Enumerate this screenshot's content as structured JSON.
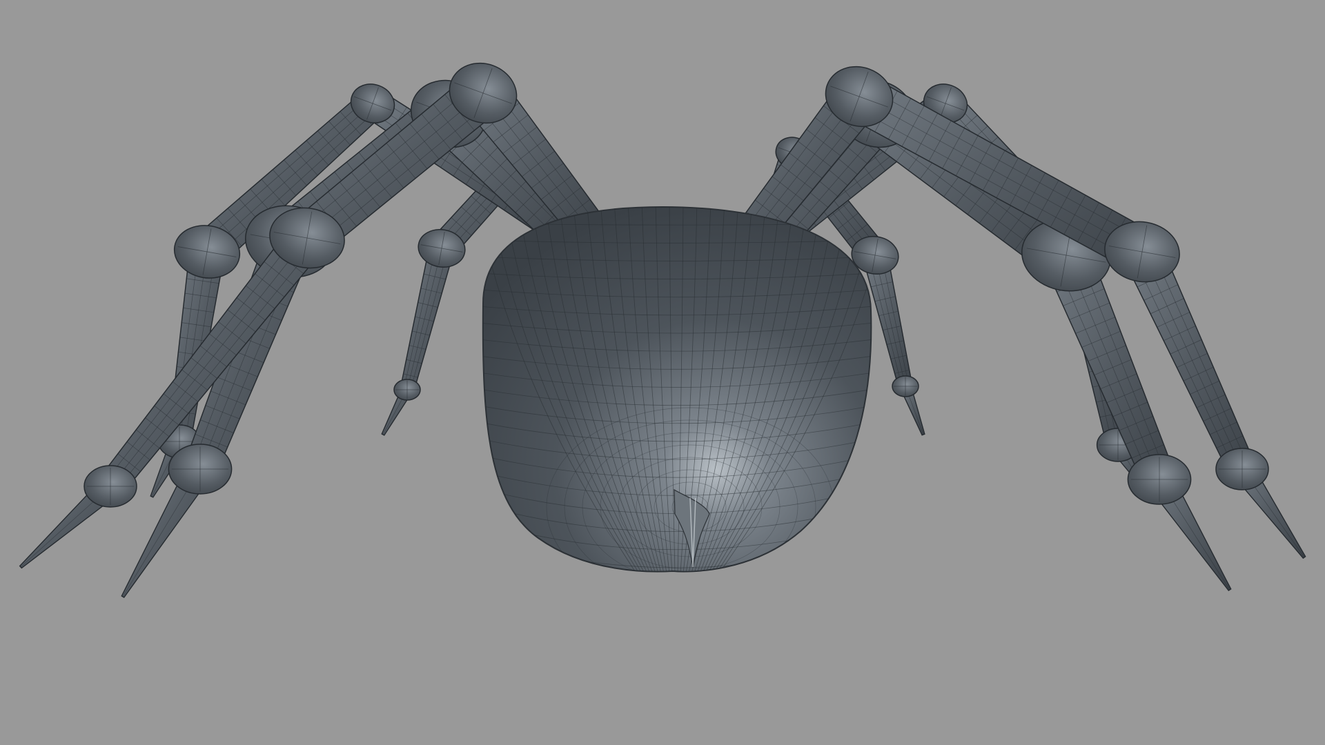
{
  "viewport": {
    "background": "#999999",
    "subject": "spider-mesh"
  },
  "mesh": {
    "base_color": "#4f565e",
    "highlight_color": "#8d959d",
    "shadow_color": "#30353b",
    "wire_color": "#262b30"
  }
}
